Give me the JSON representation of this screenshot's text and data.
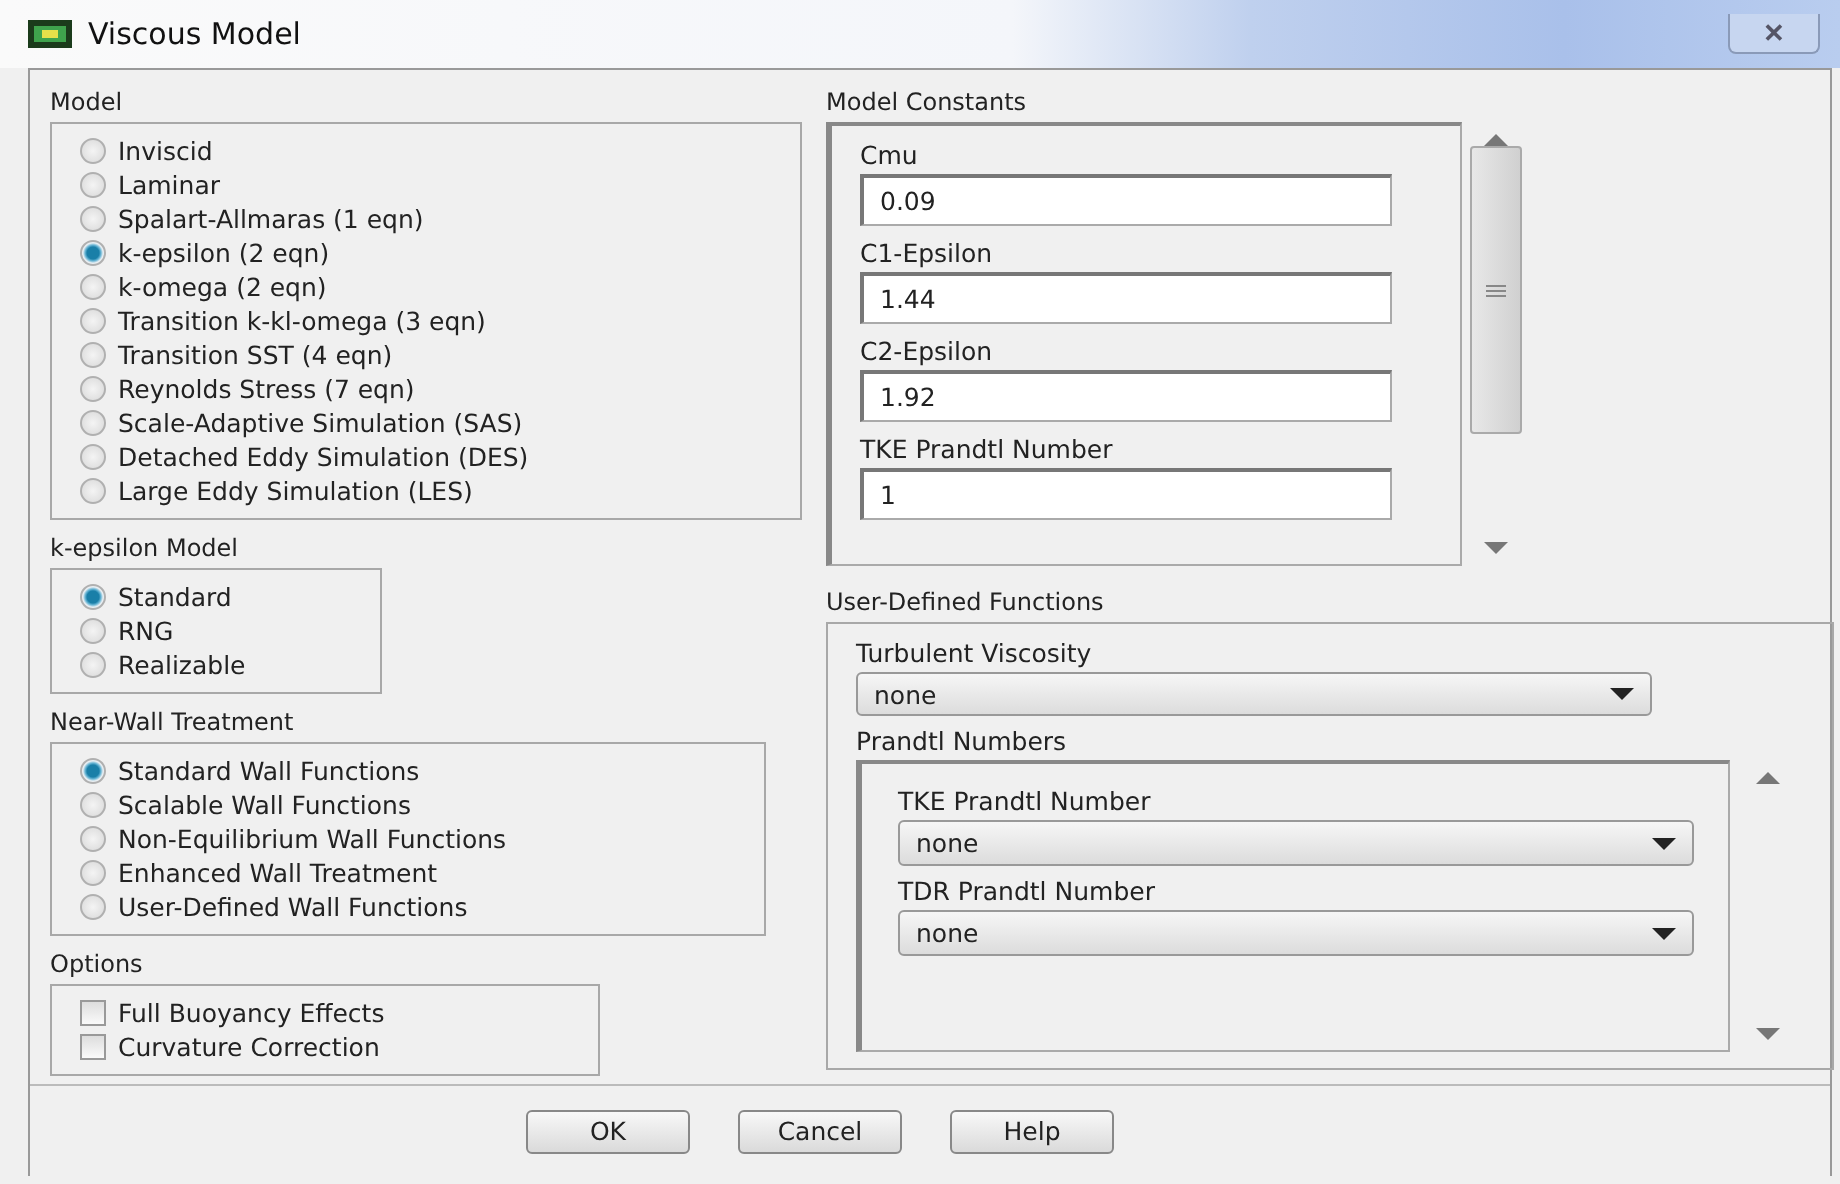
{
  "window": {
    "title": "Viscous Model",
    "close": "✕"
  },
  "model": {
    "label": "Model",
    "options": [
      {
        "label": "Inviscid",
        "selected": false
      },
      {
        "label": "Laminar",
        "selected": false
      },
      {
        "label": "Spalart-Allmaras (1 eqn)",
        "selected": false
      },
      {
        "label": "k-epsilon (2 eqn)",
        "selected": true
      },
      {
        "label": "k-omega (2 eqn)",
        "selected": false
      },
      {
        "label": "Transition k-kl-omega (3 eqn)",
        "selected": false
      },
      {
        "label": "Transition SST (4 eqn)",
        "selected": false
      },
      {
        "label": "Reynolds Stress (7 eqn)",
        "selected": false
      },
      {
        "label": "Scale-Adaptive Simulation (SAS)",
        "selected": false
      },
      {
        "label": "Detached Eddy Simulation (DES)",
        "selected": false
      },
      {
        "label": "Large Eddy Simulation (LES)",
        "selected": false
      }
    ]
  },
  "k_epsilon_model": {
    "label": "k-epsilon Model",
    "options": [
      {
        "label": "Standard",
        "selected": true
      },
      {
        "label": "RNG",
        "selected": false
      },
      {
        "label": "Realizable",
        "selected": false
      }
    ]
  },
  "near_wall_treatment": {
    "label": "Near-Wall Treatment",
    "options": [
      {
        "label": "Standard Wall Functions",
        "selected": true
      },
      {
        "label": "Scalable Wall Functions",
        "selected": false
      },
      {
        "label": "Non-Equilibrium Wall Functions",
        "selected": false
      },
      {
        "label": "Enhanced Wall Treatment",
        "selected": false
      },
      {
        "label": "User-Defined Wall Functions",
        "selected": false
      }
    ]
  },
  "options": {
    "label": "Options",
    "items": [
      {
        "label": "Full Buoyancy Effects",
        "checked": false
      },
      {
        "label": "Curvature Correction",
        "checked": false
      }
    ]
  },
  "model_constants": {
    "label": "Model Constants",
    "fields": [
      {
        "label": "Cmu",
        "value": "0.09"
      },
      {
        "label": "C1-Epsilon",
        "value": "1.44"
      },
      {
        "label": "C2-Epsilon",
        "value": "1.92"
      },
      {
        "label": "TKE Prandtl Number",
        "value": "1"
      }
    ]
  },
  "user_defined_functions": {
    "label": "User-Defined Functions",
    "turbulent_viscosity": {
      "label": "Turbulent Viscosity",
      "value": "none"
    },
    "prandtl_numbers": {
      "label": "Prandtl Numbers",
      "fields": [
        {
          "label": "TKE Prandtl Number",
          "value": "none"
        },
        {
          "label": "TDR Prandtl Number",
          "value": "none"
        }
      ]
    }
  },
  "buttons": [
    "OK",
    "Cancel",
    "Help"
  ]
}
